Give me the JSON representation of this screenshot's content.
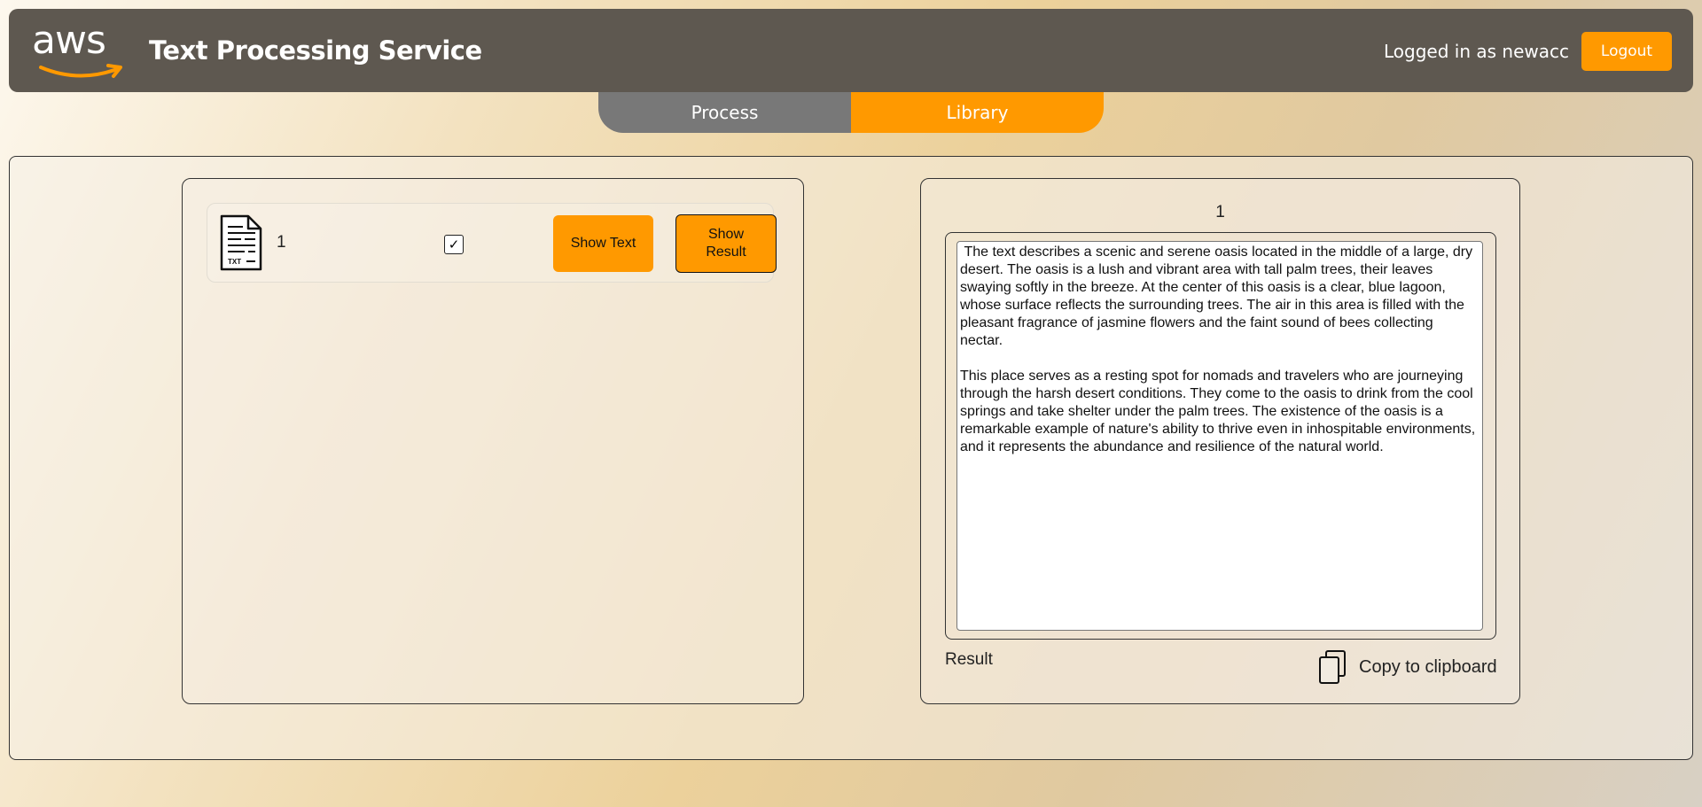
{
  "header": {
    "logo_text": "aws",
    "title": "Text Processing Service",
    "user_label": "Logged in as newacc",
    "logout_label": "Logout"
  },
  "tabs": [
    {
      "label": "Process",
      "active": false
    },
    {
      "label": "Library",
      "active": true
    }
  ],
  "library": {
    "items": [
      {
        "icon": "txt-file-icon",
        "name": "1",
        "checked": true,
        "show_text_label": "Show Text",
        "show_result_label": "Show Result"
      }
    ]
  },
  "result_panel": {
    "item_id": "1",
    "text": " The text describes a scenic and serene oasis located in the middle of a large, dry desert. The oasis is a lush and vibrant area with tall palm trees, their leaves swaying softly in the breeze. At the center of this oasis is a clear, blue lagoon, whose surface reflects the surrounding trees. The air in this area is filled with the pleasant fragrance of jasmine flowers and the faint sound of bees collecting nectar.\n\nThis place serves as a resting spot for nomads and travelers who are journeying through the harsh desert conditions. They come to the oasis to drink from the cool springs and take shelter under the palm trees. The existence of the oasis is a remarkable example of nature's ability to thrive even in inhospitable environments, and it represents the abundance and resilience of the natural world.",
    "label": "Result",
    "copy_label": "Copy to clipboard",
    "copy_icon": "copy-icon"
  },
  "colors": {
    "accent": "#ff9900",
    "header_bg": "#5e5850",
    "tab_inactive": "#787878"
  }
}
